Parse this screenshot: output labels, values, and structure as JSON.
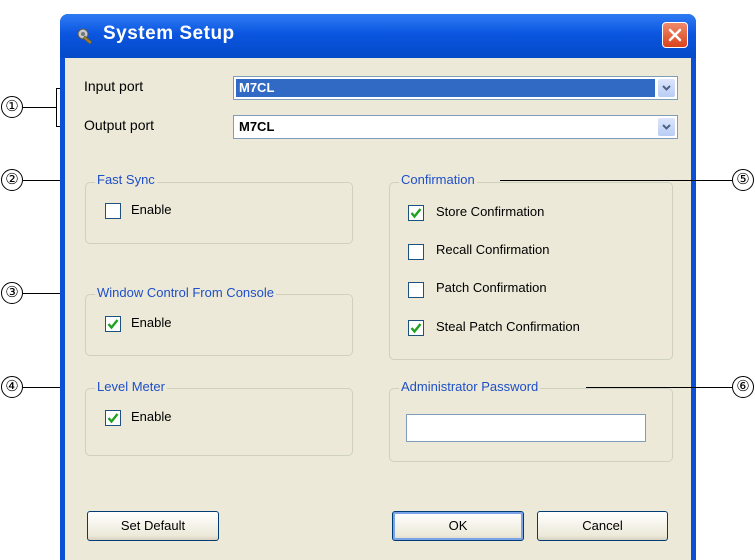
{
  "window": {
    "title": "System Setup",
    "colors": {
      "titlebar": "#0b56e0",
      "client": "#ece9d8",
      "group_title": "#1e4fc8",
      "close": "#d9421c"
    }
  },
  "ports": {
    "input_label": "Input port",
    "input_value": "M7CL",
    "output_label": "Output port",
    "output_value": "M7CL"
  },
  "fast_sync": {
    "title": "Fast Sync",
    "enable_label": "Enable",
    "checked": false
  },
  "window_control": {
    "title": "Window Control From Console",
    "enable_label": "Enable",
    "checked": true
  },
  "level_meter": {
    "title": "Level Meter",
    "enable_label": "Enable",
    "checked": true
  },
  "confirmation": {
    "title": "Confirmation",
    "items": [
      {
        "label": "Store Confirmation",
        "checked": true
      },
      {
        "label": "Recall Confirmation",
        "checked": false
      },
      {
        "label": "Patch Confirmation",
        "checked": false
      },
      {
        "label": "Steal Patch Confirmation",
        "checked": true
      }
    ]
  },
  "admin_password": {
    "title": "Administrator Password",
    "value": ""
  },
  "buttons": {
    "set_default": "Set Default",
    "ok": "OK",
    "cancel": "Cancel"
  },
  "callouts": [
    "①",
    "②",
    "③",
    "④",
    "⑤",
    "⑥"
  ]
}
